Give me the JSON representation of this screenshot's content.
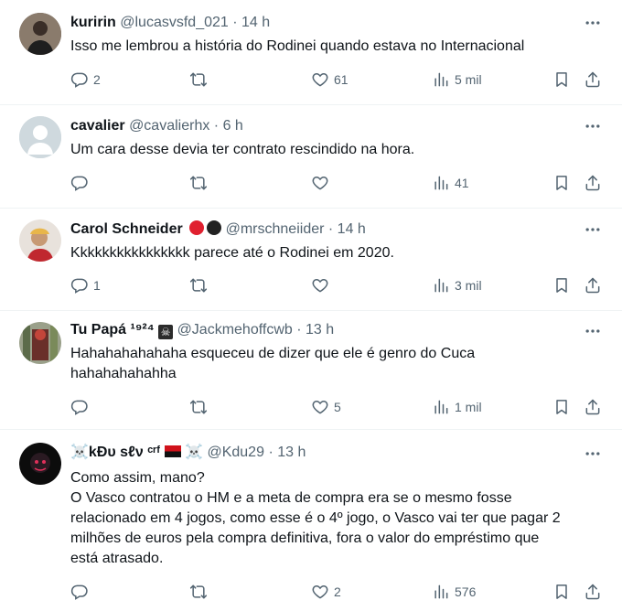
{
  "tweets": [
    {
      "name": "kuririn",
      "handle": "@lucasvsfd_021",
      "time": "14 h",
      "text": [
        "Isso me lembrou a história do Rodinei quando estava no Internacional"
      ],
      "replies": "2",
      "retweets": "",
      "likes": "61",
      "views": "5 mil"
    },
    {
      "name": "cavalier",
      "handle": "@cavalierhx",
      "time": "6 h",
      "text": [
        "Um cara desse devia ter contrato rescindido na hora."
      ],
      "replies": "",
      "retweets": "",
      "likes": "",
      "views": "41"
    },
    {
      "name": "Carol Schneider",
      "handle": "@mrschneiider",
      "time": "14 h",
      "text": [
        "Kkkkkkkkkkkkkkkk parece até o Rodinei em 2020."
      ],
      "replies": "1",
      "retweets": "",
      "likes": "",
      "views": "3 mil"
    },
    {
      "name": "Tu Papá ¹⁹²⁴",
      "handle": "@Jackmehoffcwb",
      "time": "13 h",
      "text": [
        "Hahahahahahaha esqueceu de dizer que ele é genro do Cuca",
        "hahahahahahha"
      ],
      "replies": "",
      "retweets": "",
      "likes": "5",
      "views": "1 mil"
    },
    {
      "name": "☠️kÐυ ѕℓν ᶜʳᶠ",
      "handle": "@Kdu29",
      "time": "13 h",
      "text": [
        "Como assim, mano?",
        "O Vasco contratou o HM e a meta de compra era se o mesmo fosse",
        "relacionado em 4 jogos, como esse é o 4º jogo, o Vasco vai ter que pagar 2",
        "milhões de euros pela compra definitiva, fora o valor do empréstimo que",
        "está atrasado."
      ],
      "replies": "",
      "retweets": "",
      "likes": "2",
      "views": "576"
    }
  ],
  "separator": "·",
  "icons": {
    "more": "more-horizontal-icon",
    "reply": "reply-icon",
    "retweet": "retweet-icon",
    "like": "heart-icon",
    "views": "views-chart-icon",
    "bookmark": "bookmark-icon",
    "share": "share-icon"
  },
  "colors": {
    "text": "#0f1419",
    "muted": "#536471",
    "divider": "#eff3f4",
    "flag_red": "#e0202f",
    "flag_black": "#222222"
  }
}
